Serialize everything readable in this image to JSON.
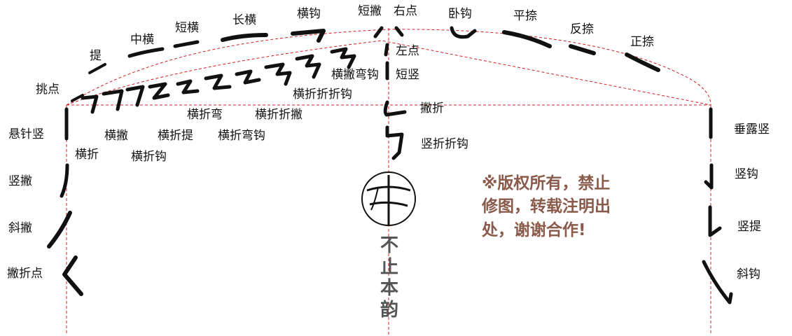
{
  "strokes": [
    "提",
    "中横",
    "短横",
    "长横",
    "横钩",
    "短撇",
    "右点",
    "卧钩",
    "平捺",
    "反捺",
    "正捺",
    "左点",
    "横撇弯钩",
    "短竖",
    "横折折折钩",
    "挑点",
    "撇折",
    "横折弯",
    "横折折撇",
    "竖折折钩",
    "悬针竖",
    "横撇",
    "横折提",
    "横折弯钩",
    "横折",
    "横折钩",
    "竖撇",
    "斜撇",
    "撇折点",
    "垂露竖",
    "竖钩",
    "竖提",
    "斜钩"
  ],
  "notice": "※版权所有，禁止\n修图，转载注明出\n处，谢谢合作!",
  "title_chars": [
    "不",
    "止",
    "本",
    "韵"
  ],
  "colors": {
    "guide": "#d42020",
    "ink": "#111111",
    "notice": "#8a5a4a",
    "title": "#555555"
  }
}
